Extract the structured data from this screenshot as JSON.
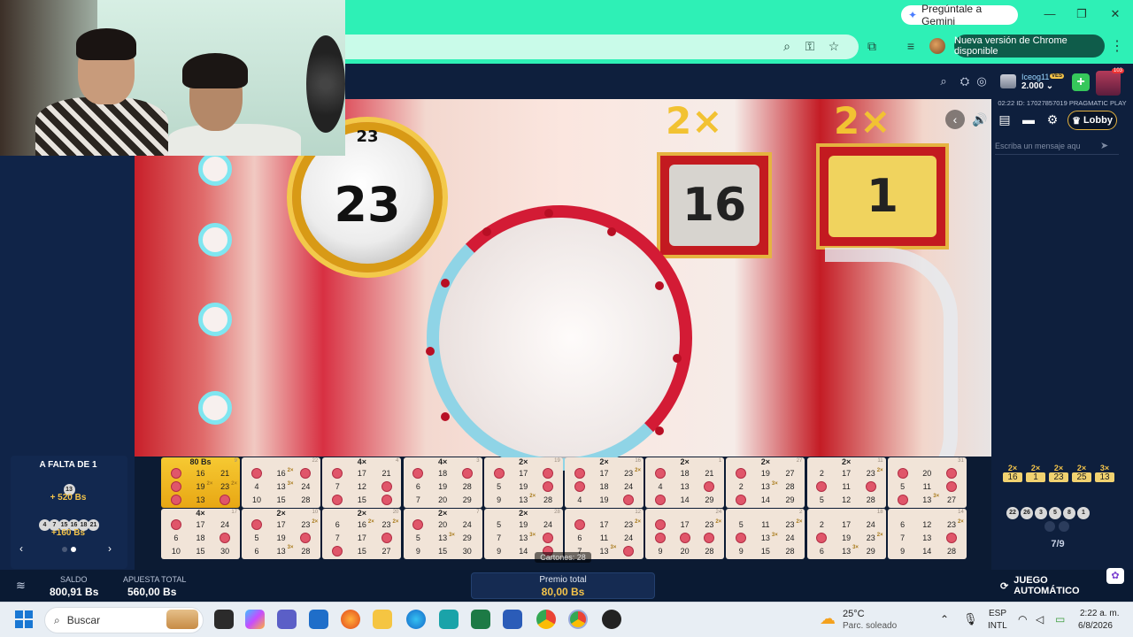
{
  "browser": {
    "gemini_label": "Pregúntale a Gemini",
    "update_label": "Nueva versión de Chrome disponible"
  },
  "game": {
    "user": {
      "name": "Iceog11",
      "badge": "VES",
      "balance": "2.000 ⌄",
      "notifications": "103"
    },
    "session_id": "02:22 ID: 17027857019 PRAGMATIC PLAY",
    "lobby_label": "Lobby",
    "chat_placeholder": "Escriba un mensaje aqu",
    "current_ball": "23",
    "current_ball_top": "23",
    "big_multiplier_left": "2×",
    "big_multiplier_right": "2×",
    "sign_numbers": [
      "16",
      "1"
    ],
    "left_panel": {
      "title": "A FALTA DE 1",
      "single_ball": "13",
      "single_prize": "+ 520 Bs",
      "ball_group": [
        "4",
        "7",
        "15",
        "16",
        "18",
        "21"
      ],
      "group_prize": "+160 Bs"
    },
    "cards": [
      {
        "head": "80 Bs",
        "idx": "9",
        "cells": [
          "",
          "16",
          "21",
          "",
          "19",
          "23",
          "",
          "13",
          ""
        ],
        "marked": [
          0,
          3,
          6,
          8
        ],
        "mults": {
          "4": "2×",
          "5": "2×"
        }
      },
      {
        "head": "",
        "idx": "22",
        "cells": [
          "",
          "16",
          "",
          "4",
          "13",
          "24",
          "10",
          "15",
          "28"
        ],
        "marked": [
          0,
          2
        ],
        "mults": {
          "1": "2×",
          "4": "3×"
        }
      },
      {
        "head": "4×",
        "idx": "4",
        "cells": [
          "",
          "17",
          "21",
          "7",
          "12",
          "",
          "",
          "15",
          ""
        ],
        "marked": [
          0,
          5,
          6,
          8
        ],
        "mults": {}
      },
      {
        "head": "4×",
        "idx": "3",
        "cells": [
          "",
          "18",
          "",
          "6",
          "19",
          "28",
          "7",
          "20",
          "29"
        ],
        "marked": [
          0,
          2
        ],
        "mults": {}
      },
      {
        "head": "2×",
        "idx": "19",
        "cells": [
          "",
          "17",
          "",
          "5",
          "19",
          "",
          "9",
          "13",
          "28"
        ],
        "marked": [
          0,
          2,
          5
        ],
        "mults": {
          "7": "2×"
        }
      },
      {
        "head": "2×",
        "idx": "16",
        "cells": [
          "",
          "17",
          "23",
          "",
          "18",
          "24",
          "4",
          "19",
          ""
        ],
        "marked": [
          0,
          3,
          8
        ],
        "mults": {
          "2": "2×"
        }
      },
      {
        "head": "2×",
        "idx": "1",
        "cells": [
          "",
          "18",
          "21",
          "4",
          "13",
          "",
          "",
          "14",
          "29"
        ],
        "marked": [
          0,
          5,
          6
        ],
        "mults": {}
      },
      {
        "head": "2×",
        "idx": "27",
        "cells": [
          "",
          "19",
          "27",
          "2",
          "13",
          "28",
          "",
          "14",
          "29"
        ],
        "marked": [
          0,
          6
        ],
        "mults": {
          "4": "3×"
        }
      },
      {
        "head": "2×",
        "idx": "11",
        "cells": [
          "2",
          "17",
          "23",
          "",
          "11",
          "",
          "5",
          "12",
          "28"
        ],
        "marked": [
          3,
          5
        ],
        "mults": {
          "2": "2×"
        }
      },
      {
        "head": "",
        "idx": "31",
        "cells": [
          "",
          "20",
          "",
          "5",
          "11",
          "",
          "",
          "13",
          "27"
        ],
        "marked": [
          0,
          2,
          5,
          6
        ],
        "mults": {
          "7": "3×"
        }
      },
      {
        "head": "4×",
        "idx": "17",
        "cells": [
          "",
          "17",
          "24",
          "6",
          "18",
          "",
          "10",
          "15",
          "30"
        ],
        "marked": [
          0,
          5
        ],
        "mults": {}
      },
      {
        "head": "2×",
        "idx": "10",
        "cells": [
          "",
          "17",
          "23",
          "5",
          "19",
          "",
          "6",
          "13",
          "28"
        ],
        "marked": [
          0,
          5
        ],
        "mults": {
          "2": "2×",
          "7": "3×"
        }
      },
      {
        "head": "2×",
        "idx": "20",
        "cells": [
          "6",
          "16",
          "23",
          "7",
          "17",
          "",
          "",
          "15",
          "27"
        ],
        "marked": [
          5,
          6
        ],
        "mults": {
          "1": "2×",
          "2": "2×"
        }
      },
      {
        "head": "2×",
        "idx": "7",
        "cells": [
          "",
          "20",
          "24",
          "5",
          "13",
          "29",
          "9",
          "15",
          "30"
        ],
        "marked": [
          0
        ],
        "mults": {
          "4": "3×"
        }
      },
      {
        "head": "2×",
        "idx": "28",
        "cells": [
          "5",
          "19",
          "24",
          "7",
          "13",
          "",
          "9",
          "14",
          ""
        ],
        "marked": [
          5,
          8
        ],
        "mults": {
          "4": "3×"
        }
      },
      {
        "head": "",
        "idx": "12",
        "cells": [
          "",
          "17",
          "23",
          "6",
          "11",
          "24",
          "7",
          "13",
          ""
        ],
        "marked": [
          0,
          8
        ],
        "mults": {
          "2": "2×",
          "7": "3×"
        }
      },
      {
        "head": "",
        "idx": "24",
        "cells": [
          "",
          "17",
          "23",
          "",
          "",
          "",
          "9",
          "20",
          "28"
        ],
        "marked": [
          0,
          3,
          4,
          5
        ],
        "mults": {
          "2": "2×"
        }
      },
      {
        "head": "",
        "idx": "2",
        "cells": [
          "5",
          "11",
          "23",
          "",
          "13",
          "24",
          "9",
          "15",
          "28"
        ],
        "marked": [
          3
        ],
        "mults": {
          "2": "2×",
          "4": "3×"
        }
      },
      {
        "head": "",
        "idx": "18",
        "cells": [
          "2",
          "17",
          "24",
          "",
          "19",
          "23",
          "6",
          "13",
          "29"
        ],
        "marked": [
          3
        ],
        "mults": {
          "5": "2×",
          "7": "3×"
        }
      },
      {
        "head": "",
        "idx": "14",
        "cells": [
          "6",
          "12",
          "23",
          "7",
          "13",
          "",
          "9",
          "14",
          "28"
        ],
        "marked": [
          5
        ],
        "mults": {
          "2": "2×"
        }
      }
    ],
    "cartones": "Cartones: 28",
    "right_multipliers": [
      {
        "mult": "2×",
        "num": "16"
      },
      {
        "mult": "2×",
        "num": "1"
      },
      {
        "mult": "2×",
        "num": "23"
      },
      {
        "mult": "2×",
        "num": "25"
      },
      {
        "mult": "3×",
        "num": "13"
      }
    ],
    "called_balls": [
      "22",
      "26",
      "3",
      "5",
      "8",
      "1"
    ],
    "progress": "7/9",
    "saldo_label": "SALDO",
    "saldo_value": "800,91 Bs",
    "apuesta_label": "APUESTA TOTAL",
    "apuesta_value": "560,00 Bs",
    "premio_label": "Premio total",
    "premio_value": "80,00 Bs",
    "auto_label": "JUEGO AUTOMÁTICO"
  },
  "taskbar": {
    "search_placeholder": "Buscar",
    "weather_temp": "25°C",
    "weather_desc": "Parc. soleado",
    "lang_top": "ESP",
    "lang_bottom": "INTL",
    "time": "2:22 a. m.",
    "date": "6/8/2026"
  },
  "colors": {
    "chrome_accent": "#2ef0b6",
    "game_bg": "#0e1f3d",
    "gold": "#f3c34a",
    "mark_red": "#e0566a"
  }
}
